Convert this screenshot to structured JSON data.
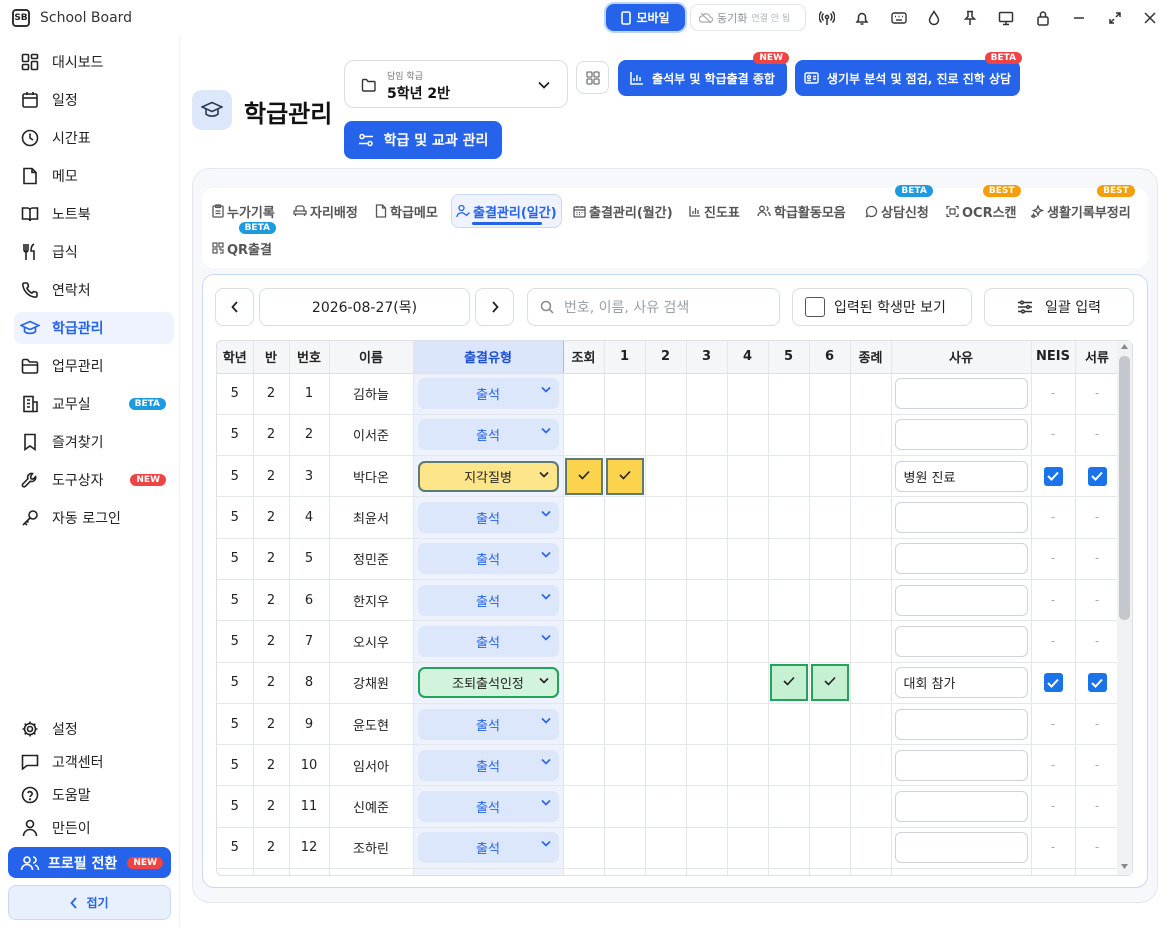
{
  "app": {
    "title": "School Board",
    "logo_text": "SB"
  },
  "titlebar": {
    "mobile_label": "모바일",
    "sync_label": "동기화",
    "sync_sub": "연결 안 됨"
  },
  "sidebar": {
    "items": [
      {
        "label": "대시보드",
        "icon": "dashboard-icon"
      },
      {
        "label": "일정",
        "icon": "calendar-icon"
      },
      {
        "label": "시간표",
        "icon": "clock-icon"
      },
      {
        "label": "메모",
        "icon": "memo-icon"
      },
      {
        "label": "노트북",
        "icon": "book-icon"
      },
      {
        "label": "급식",
        "icon": "utensils-icon"
      },
      {
        "label": "연락처",
        "icon": "phone-icon"
      },
      {
        "label": "학급관리",
        "icon": "graduation-cap-icon",
        "active": true
      },
      {
        "label": "업무관리",
        "icon": "folder-icon"
      },
      {
        "label": "교무실",
        "icon": "building-icon",
        "badge": "BETA"
      },
      {
        "label": "즐겨찾기",
        "icon": "bookmark-icon"
      },
      {
        "label": "도구상자",
        "icon": "wrench-icon",
        "badge": "NEW"
      },
      {
        "label": "자동 로그인",
        "icon": "key-icon"
      }
    ],
    "bottom_items": [
      {
        "label": "설정",
        "icon": "gear-icon"
      },
      {
        "label": "고객센터",
        "icon": "chat-icon"
      },
      {
        "label": "도움말",
        "icon": "help-icon"
      },
      {
        "label": "만든이",
        "icon": "person-icon"
      }
    ],
    "profile_label": "프로필 전환",
    "profile_badge": "NEW",
    "collapse_label": "접기"
  },
  "header": {
    "page_title": "학급관리",
    "class_select_label": "담임 학급",
    "class_select_value": "5학년 2반",
    "attendance_summary_label": "출석부 및 학급출결 종합",
    "attendance_summary_badge": "NEW",
    "record_analysis_label": "생기부 분석 및 점검, 진로 진학 상담",
    "record_analysis_badge": "BETA",
    "manage_label": "학급 및 교과 관리"
  },
  "tabs": [
    {
      "label": "누가기록"
    },
    {
      "label": "자리배정"
    },
    {
      "label": "학급메모"
    },
    {
      "label": "출결관리(일간)",
      "active": true
    },
    {
      "label": "출결관리(월간)"
    },
    {
      "label": "진도표"
    },
    {
      "label": "학급활동모음"
    },
    {
      "label": "상담신청",
      "badge": "BETA"
    },
    {
      "label": "OCR스캔",
      "badge": "BEST"
    },
    {
      "label": "생활기록부정리",
      "badge": "BEST"
    },
    {
      "label": "QR출결",
      "badge": "BETA"
    }
  ],
  "toolbar": {
    "date": "2026-08-27(목)",
    "search_placeholder": "번호, 이름, 사유 검색",
    "filter_label": "입력된 학생만 보기",
    "bulk_label": "일괄 입력"
  },
  "table": {
    "headers": [
      "학년",
      "반",
      "번호",
      "이름",
      "출결유형",
      "조회",
      "1",
      "2",
      "3",
      "4",
      "5",
      "6",
      "종례",
      "사유",
      "NEIS",
      "서류"
    ],
    "rows": [
      {
        "grade": "5",
        "class": "2",
        "num": "1",
        "name": "김하늘",
        "type": "출석",
        "style": "normal",
        "checks": [],
        "reason": "",
        "neis": "-",
        "docs": "-"
      },
      {
        "grade": "5",
        "class": "2",
        "num": "2",
        "name": "이서준",
        "type": "출석",
        "style": "normal",
        "checks": [],
        "reason": "",
        "neis": "-",
        "docs": "-"
      },
      {
        "grade": "5",
        "class": "2",
        "num": "3",
        "name": "박다온",
        "type": "지각질병",
        "style": "yellow",
        "checks": [
          "조회",
          "1"
        ],
        "reason": "병원 진료",
        "neis": "checked",
        "docs": "checked"
      },
      {
        "grade": "5",
        "class": "2",
        "num": "4",
        "name": "최윤서",
        "type": "출석",
        "style": "normal",
        "checks": [],
        "reason": "",
        "neis": "-",
        "docs": "-"
      },
      {
        "grade": "5",
        "class": "2",
        "num": "5",
        "name": "정민준",
        "type": "출석",
        "style": "normal",
        "checks": [],
        "reason": "",
        "neis": "-",
        "docs": "-"
      },
      {
        "grade": "5",
        "class": "2",
        "num": "6",
        "name": "한지우",
        "type": "출석",
        "style": "normal",
        "checks": [],
        "reason": "",
        "neis": "-",
        "docs": "-"
      },
      {
        "grade": "5",
        "class": "2",
        "num": "7",
        "name": "오시우",
        "type": "출석",
        "style": "normal",
        "checks": [],
        "reason": "",
        "neis": "-",
        "docs": "-"
      },
      {
        "grade": "5",
        "class": "2",
        "num": "8",
        "name": "강채원",
        "type": "조퇴출석인정",
        "style": "green",
        "checks": [
          "5",
          "6"
        ],
        "reason": "대회 참가",
        "neis": "checked",
        "docs": "checked"
      },
      {
        "grade": "5",
        "class": "2",
        "num": "9",
        "name": "윤도현",
        "type": "출석",
        "style": "normal",
        "checks": [],
        "reason": "",
        "neis": "-",
        "docs": "-"
      },
      {
        "grade": "5",
        "class": "2",
        "num": "10",
        "name": "임서아",
        "type": "출석",
        "style": "normal",
        "checks": [],
        "reason": "",
        "neis": "-",
        "docs": "-"
      },
      {
        "grade": "5",
        "class": "2",
        "num": "11",
        "name": "신예준",
        "type": "출석",
        "style": "normal",
        "checks": [],
        "reason": "",
        "neis": "-",
        "docs": "-"
      },
      {
        "grade": "5",
        "class": "2",
        "num": "12",
        "name": "조하린",
        "type": "출석",
        "style": "normal",
        "checks": [],
        "reason": "",
        "neis": "-",
        "docs": "-"
      }
    ]
  },
  "colors": {
    "accent": "#2563eb",
    "late_sick": "#fde58a",
    "excused": "#d3f4dc",
    "beta": "#1e9be0",
    "new": "#ef4444",
    "best": "#f59e0b"
  }
}
